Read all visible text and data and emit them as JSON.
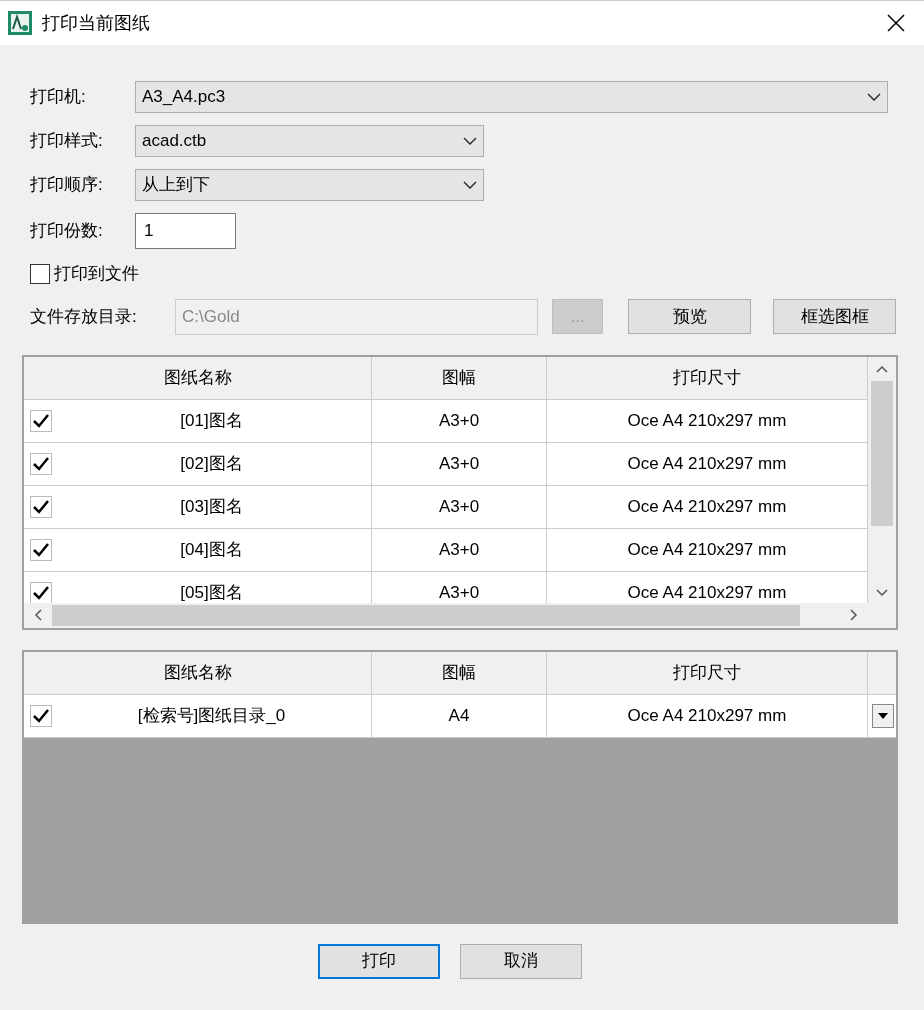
{
  "window": {
    "title": "打印当前图纸"
  },
  "fields": [
    {
      "kind": "select",
      "label": "打印机:",
      "value": "A3_A4.pc3"
    },
    {
      "kind": "select",
      "label": "打印样式:",
      "value": "acad.ctb"
    },
    {
      "kind": "select",
      "label": "打印顺序:",
      "value": "从上到下"
    },
    {
      "kind": "input",
      "label": "打印份数:",
      "value": "1"
    }
  ],
  "print_to_file": {
    "label": "打印到文件",
    "checked": false
  },
  "directory": {
    "label": "文件存放目录:",
    "value": "C:\\Gold",
    "disabled": true,
    "browse": "...",
    "browse_disabled": true
  },
  "actions": [
    "预览",
    "框选图框"
  ],
  "drawings_table": {
    "columns": [
      "图纸名称",
      "图幅",
      "打印尺寸"
    ],
    "rows": [
      {
        "checked": true,
        "cells": [
          "[01]图名",
          "A3+0",
          "Oce A4 210x297 mm"
        ]
      },
      {
        "checked": true,
        "cells": [
          "[02]图名",
          "A3+0",
          "Oce A4 210x297 mm"
        ]
      },
      {
        "checked": true,
        "cells": [
          "[03]图名",
          "A3+0",
          "Oce A4 210x297 mm"
        ]
      },
      {
        "checked": true,
        "cells": [
          "[04]图名",
          "A3+0",
          "Oce A4 210x297 mm"
        ]
      },
      {
        "checked": true,
        "cells": [
          "[05]图名",
          "A3+0",
          "Oce A4 210x297 mm"
        ]
      }
    ]
  },
  "catalog_table": {
    "columns": [
      "图纸名称",
      "图幅",
      "打印尺寸"
    ],
    "rows": [
      {
        "checked": true,
        "cells": [
          "[检索号]图纸目录_0",
          "A4",
          "Oce A4 210x297 mm"
        ]
      }
    ]
  },
  "buttons": [
    {
      "label": "打印",
      "default": true
    },
    {
      "label": "取消",
      "default": false
    }
  ]
}
